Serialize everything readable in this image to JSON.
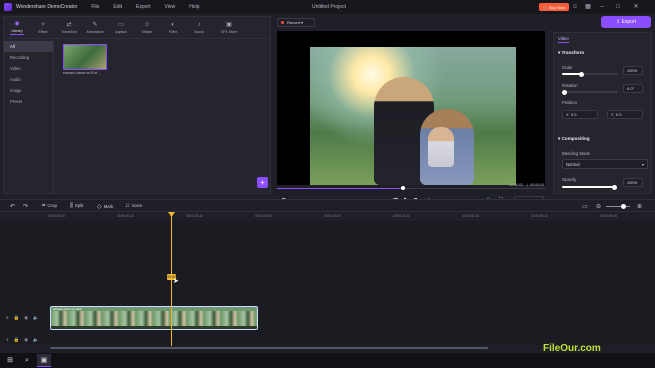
{
  "titlebar": {
    "app_name": "Wondershare DemoCreator",
    "menu": [
      "File",
      "Edit",
      "Export",
      "View",
      "Help"
    ],
    "project_title": "Untitled Project",
    "buy_now": "Buy Now"
  },
  "tools": [
    {
      "label": "Library",
      "icon": "library-icon"
    },
    {
      "label": "Effect",
      "icon": "effect-icon"
    },
    {
      "label": "Transition",
      "icon": "transition-icon"
    },
    {
      "label": "Annotation",
      "icon": "annotation-icon"
    },
    {
      "label": "Caption",
      "icon": "caption-icon"
    },
    {
      "label": "Sticker",
      "icon": "sticker-icon"
    },
    {
      "label": "Filter",
      "icon": "filter-icon"
    },
    {
      "label": "Sound",
      "icon": "sound-icon"
    },
    {
      "label": "SFX Store",
      "icon": "sfx-store-icon"
    }
  ],
  "library": {
    "categories": [
      "All",
      "Recording",
      "Video",
      "Audio",
      "Image",
      "Preset"
    ],
    "active_category": "All",
    "media": [
      {
        "name": "edward-cisneros-IEnf..."
      }
    ]
  },
  "preview": {
    "record_label": "Record",
    "time_current": "00:00:02",
    "time_total": "00:00:00",
    "fit_label": "Fit",
    "progress": 0.47
  },
  "export": {
    "label": "Export"
  },
  "properties": {
    "tab": "Video",
    "transform": {
      "title": "Transform",
      "scale_label": "Scale",
      "scale_value": "100%",
      "scale_fraction": 0.35,
      "rotation_label": "Rotation",
      "rotation_value": "0.0°",
      "position_label": "Position",
      "position_x_axis": "X",
      "position_x": "0.0",
      "position_y_axis": "Y",
      "position_y": "0.0"
    },
    "compositing": {
      "title": "Compositing",
      "blend_label": "Blending Mode",
      "blend_value": "Normal",
      "opacity_label": "Opacity",
      "opacity_value": "100%",
      "opacity_fraction": 1.0
    }
  },
  "timeline": {
    "tools": [
      "Crop",
      "Split",
      "Mark",
      "Voice"
    ],
    "ruler": [
      "00:00:00:00",
      "00:00:00:14",
      "00:00:01:10",
      "00:00:02:05",
      "00:00:03:00",
      "00:00:03:20",
      "00:00:04:15",
      "00:00:05:10",
      "00:00:06:05",
      "00:00:07:00"
    ],
    "playhead_label": "00:02",
    "clip_name": "edward-cisneros-IEnf"
  },
  "watermark": {
    "prefix": "Fi",
    "suffix": "leOur.com"
  },
  "colors": {
    "accent": "#8a4dff",
    "playhead": "#f2b935",
    "buy": "#ff5d3a"
  }
}
